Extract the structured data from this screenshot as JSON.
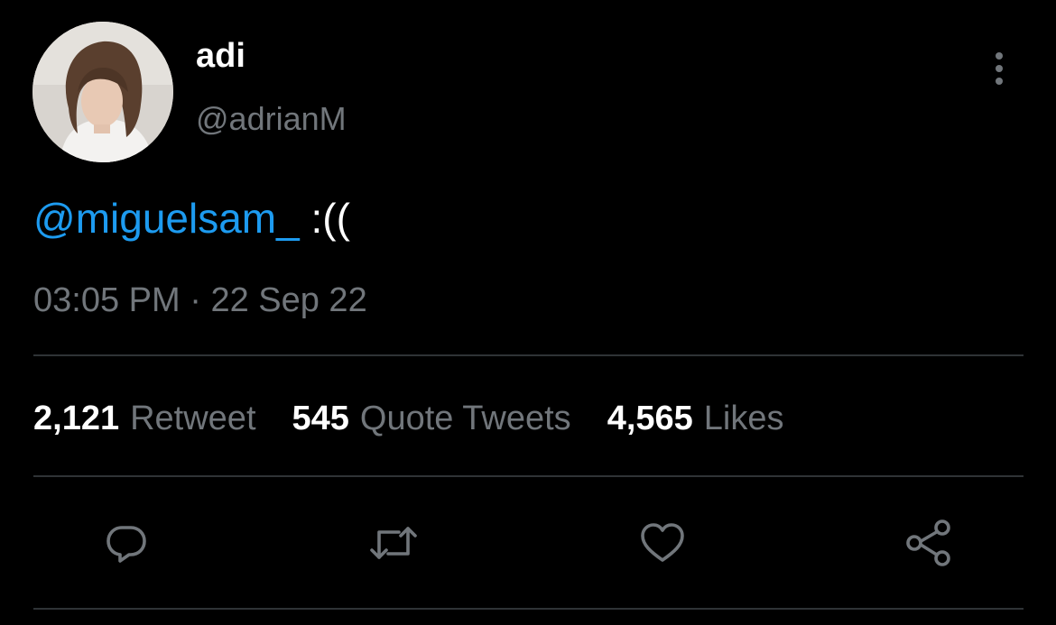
{
  "user": {
    "display_name": "adi",
    "handle": "@adrianM"
  },
  "tweet": {
    "mention": "@miguelsam_",
    "text": " :(("
  },
  "timestamp": {
    "time": "03:05 PM",
    "separator": " · ",
    "date": "22 Sep 22"
  },
  "stats": [
    {
      "count": "2,121",
      "label": "Retweet"
    },
    {
      "count": "545",
      "label": "Quote Tweets"
    },
    {
      "count": "4,565",
      "label": "Likes"
    }
  ],
  "icons": {
    "more": "more-vertical-icon",
    "reply": "reply-icon",
    "retweet": "retweet-icon",
    "like": "heart-icon",
    "share": "share-icon"
  },
  "colors": {
    "background": "#000000",
    "text_primary": "#ffffff",
    "text_secondary": "#71767b",
    "link": "#1d9bf0",
    "divider": "#2f3336"
  }
}
